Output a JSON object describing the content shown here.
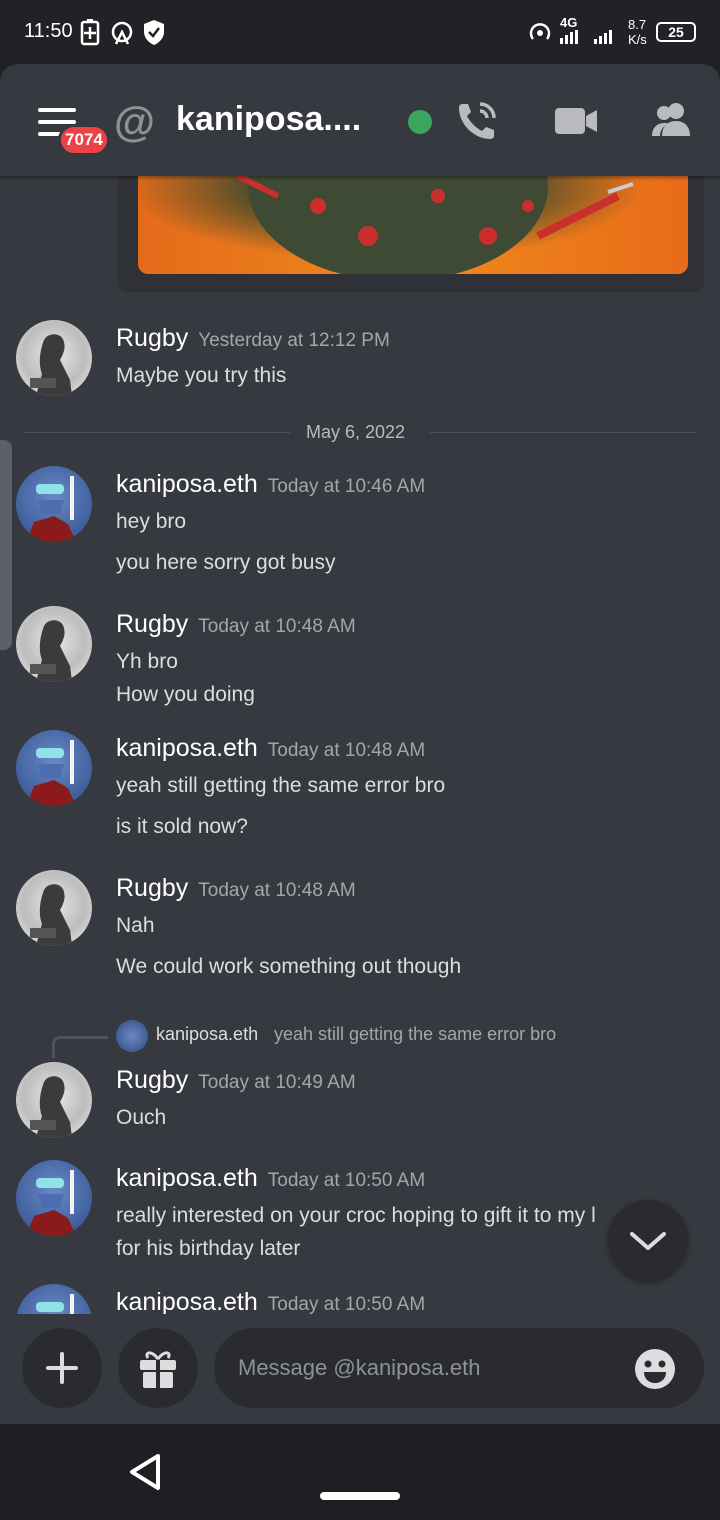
{
  "status_bar": {
    "time": "11:50",
    "network": "4G",
    "speed_value": "8.7",
    "speed_unit": "K/s",
    "battery": "25"
  },
  "header": {
    "title": "kaniposa....",
    "notification_count": "7074",
    "status_color": "#3ba55d"
  },
  "divider": {
    "date": "May 6, 2022"
  },
  "messages": [
    {
      "author": "Rugby",
      "timestamp": "Yesterday at 12:12 PM",
      "lines": [
        "Maybe you try this"
      ]
    },
    {
      "author": "kaniposa.eth",
      "timestamp": "Today at 10:46 AM",
      "lines": [
        "hey bro",
        "you here sorry got busy"
      ]
    },
    {
      "author": "Rugby",
      "timestamp": "Today at 10:48 AM",
      "lines": [
        "Yh bro",
        "How you doing"
      ]
    },
    {
      "author": "kaniposa.eth",
      "timestamp": "Today at 10:48 AM",
      "lines": [
        "yeah still getting the same error bro",
        "is it sold now?"
      ]
    },
    {
      "author": "Rugby",
      "timestamp": "Today at 10:48 AM",
      "lines": [
        "Nah",
        "We could work something out though"
      ]
    },
    {
      "author": "Rugby",
      "timestamp": "Today at 10:49 AM",
      "lines": [
        "Ouch"
      ]
    },
    {
      "author": "kaniposa.eth",
      "timestamp": "Today at 10:50 AM",
      "lines": [
        "really interested on your croc hoping to gift it to my l",
        "for his birthday later"
      ]
    },
    {
      "author": "kaniposa.eth",
      "timestamp": "Today at 10:50 AM",
      "lines": []
    }
  ],
  "reply": {
    "author": "kaniposa.eth",
    "text": "yeah still getting the same error bro"
  },
  "composer": {
    "placeholder": "Message @kaniposa.eth"
  },
  "colors": {
    "background": "#36393f",
    "accent_red": "#ed4245",
    "online_green": "#3ba55d"
  }
}
